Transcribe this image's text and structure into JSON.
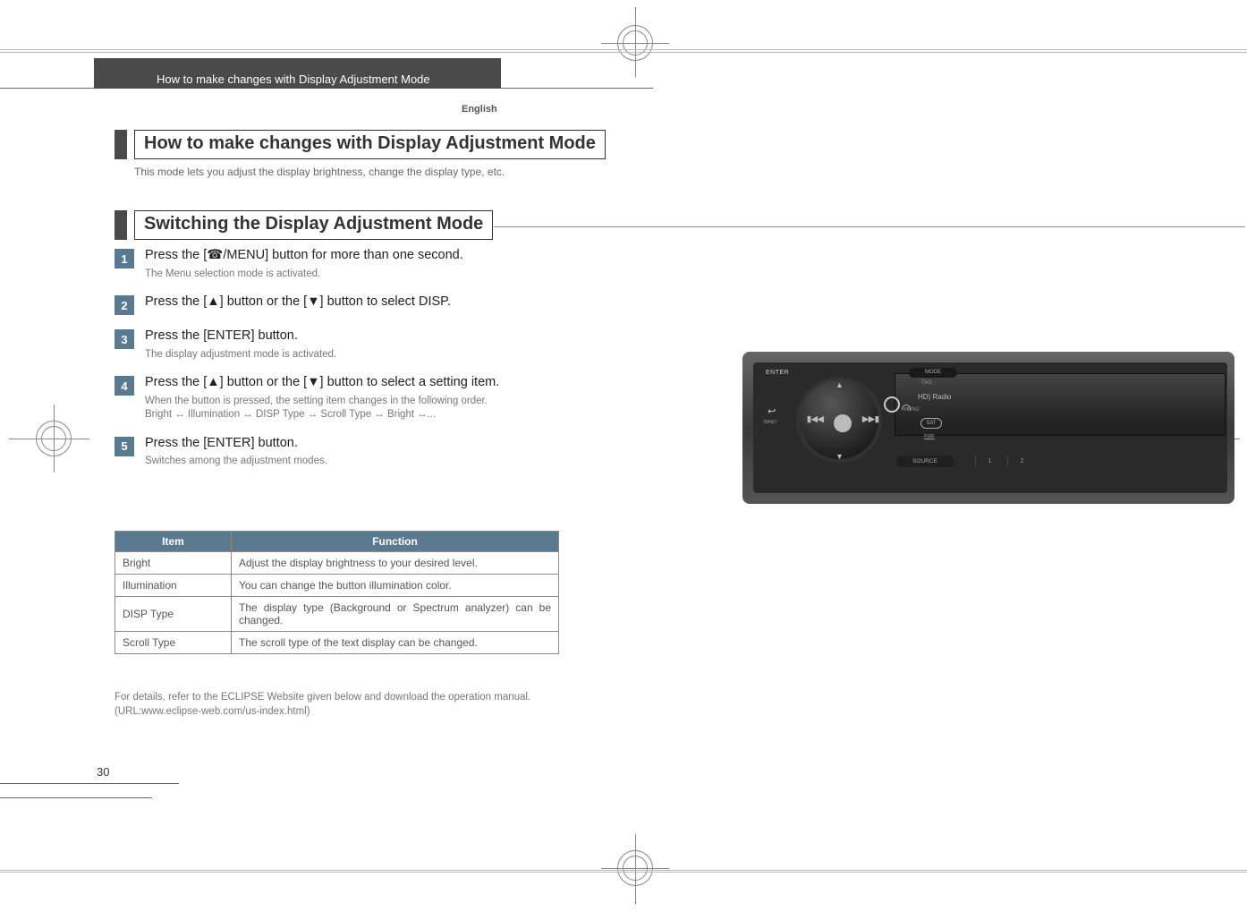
{
  "header": {
    "chapter": "How to make changes with Display Adjustment Mode",
    "language": "English"
  },
  "section1": {
    "title": "How to make changes with Display Adjustment Mode",
    "lead": "This mode lets you adjust the display brightness, change the display type, etc."
  },
  "section2": {
    "title": "Switching the Display Adjustment Mode"
  },
  "steps": [
    {
      "num": "1",
      "title": "Press the [☎/MENU] button for more than one second.",
      "desc": "The Menu selection mode is activated."
    },
    {
      "num": "2",
      "title": "Press the [▲] button or the [▼]  button to select DISP.",
      "desc": ""
    },
    {
      "num": "3",
      "title": "Press the [ENTER] button.",
      "desc": "The display adjustment mode is activated."
    },
    {
      "num": "4",
      "title": "Press the [▲] button or the [▼] button to select a setting item.",
      "desc": "When the button is pressed, the setting item changes in the following order.\nBright ↔ Illumination ↔ DISP Type ↔ Scroll Type ↔ Bright ↔..."
    },
    {
      "num": "5",
      "title": "Press the [ENTER] button.",
      "desc": "Switches among the adjustment modes."
    }
  ],
  "table": {
    "head": {
      "item": "Item",
      "func": "Function"
    },
    "rows": [
      {
        "item": "Bright",
        "func": "Adjust the display brightness to your desired level."
      },
      {
        "item": "Illumination",
        "func": "You can change the button illumination color."
      },
      {
        "item": "DISP Type",
        "func": "The display type (Background or Spectrum analyzer) can be changed."
      },
      {
        "item": "Scroll Type",
        "func": "The scroll type of the text display can be changed."
      }
    ]
  },
  "footnote": {
    "line1": "For details, refer to the ECLIPSE Website given below and download the operation manual.",
    "line2": "(URL:www.eclipse-web.com/us-index.html)"
  },
  "page_number": "30",
  "device": {
    "enter": "ENTER",
    "mode": "MODE",
    "tag": "TAG",
    "hd": "HD) Radio",
    "sat": "SAT",
    "menu": "MENU",
    "back": "↩",
    "band": "BAND",
    "pwr": "PWR",
    "source": "SOURCE",
    "b1": "1",
    "b2": "2",
    "up": "▲",
    "dn": "▼",
    "l": "▮◀◀",
    "r": "▶▶▮"
  }
}
